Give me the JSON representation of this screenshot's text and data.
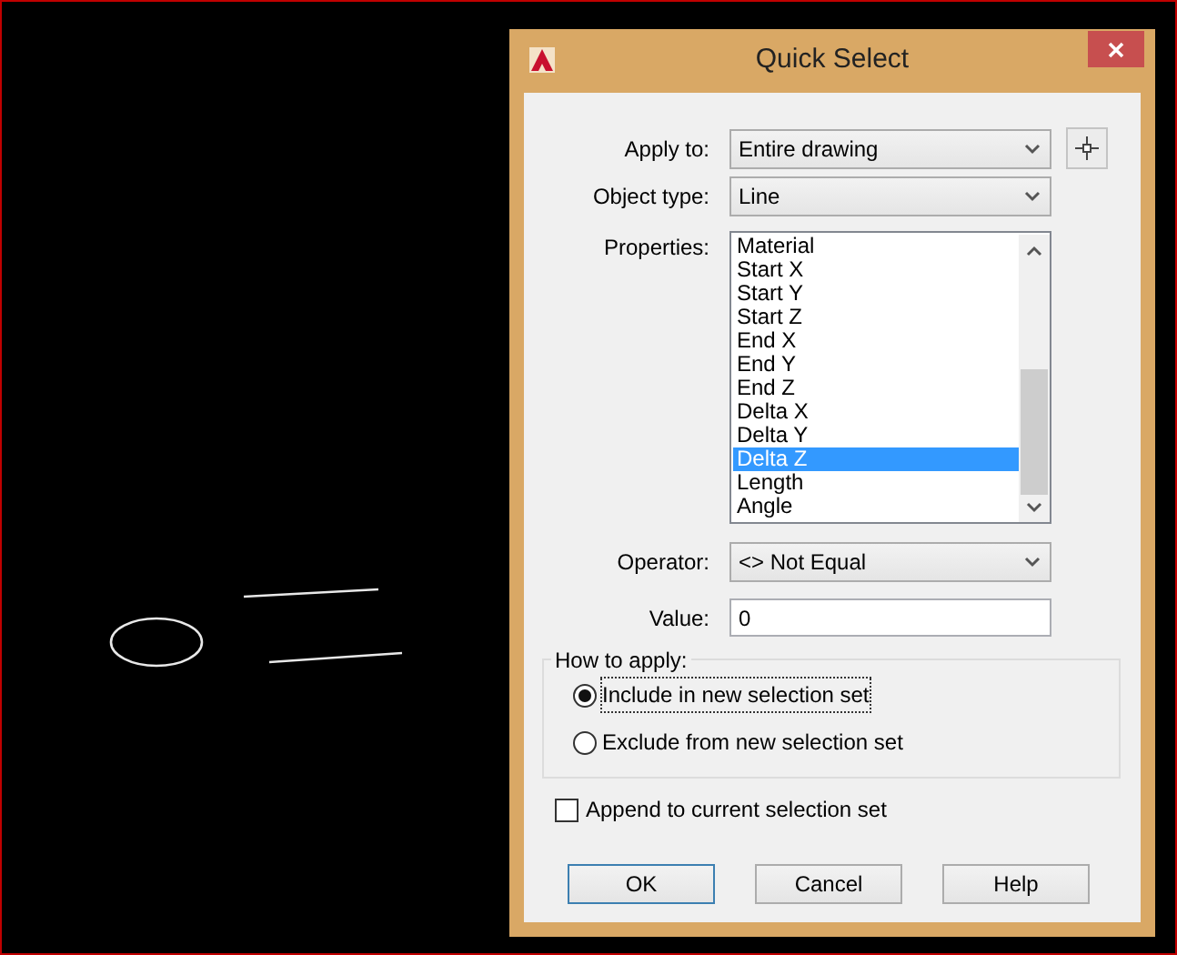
{
  "window": {
    "title": "Quick Select"
  },
  "apply_to": {
    "label": "Apply to:",
    "value": "Entire drawing"
  },
  "object_type": {
    "label": "Object type:",
    "value": "Line"
  },
  "properties": {
    "label": "Properties:",
    "items": [
      {
        "label": "Material",
        "selected": false
      },
      {
        "label": "Start X",
        "selected": false
      },
      {
        "label": "Start Y",
        "selected": false
      },
      {
        "label": "Start Z",
        "selected": false
      },
      {
        "label": "End X",
        "selected": false
      },
      {
        "label": "End Y",
        "selected": false
      },
      {
        "label": "End Z",
        "selected": false
      },
      {
        "label": "Delta X",
        "selected": false
      },
      {
        "label": "Delta Y",
        "selected": false
      },
      {
        "label": "Delta Z",
        "selected": true
      },
      {
        "label": "Length",
        "selected": false
      },
      {
        "label": "Angle",
        "selected": false
      }
    ]
  },
  "operator": {
    "label": "Operator:",
    "value": "<> Not Equal"
  },
  "value": {
    "label": "Value:",
    "value": "0"
  },
  "how_to_apply": {
    "title": "How to apply:",
    "options": [
      {
        "label": "Include in new selection set",
        "selected": true
      },
      {
        "label": "Exclude from new selection set",
        "selected": false
      }
    ]
  },
  "append": {
    "label": "Append to current selection set",
    "checked": false
  },
  "buttons": [
    {
      "label": "OK",
      "default": true
    },
    {
      "label": "Cancel",
      "default": false
    },
    {
      "label": "Help",
      "default": false
    }
  ]
}
